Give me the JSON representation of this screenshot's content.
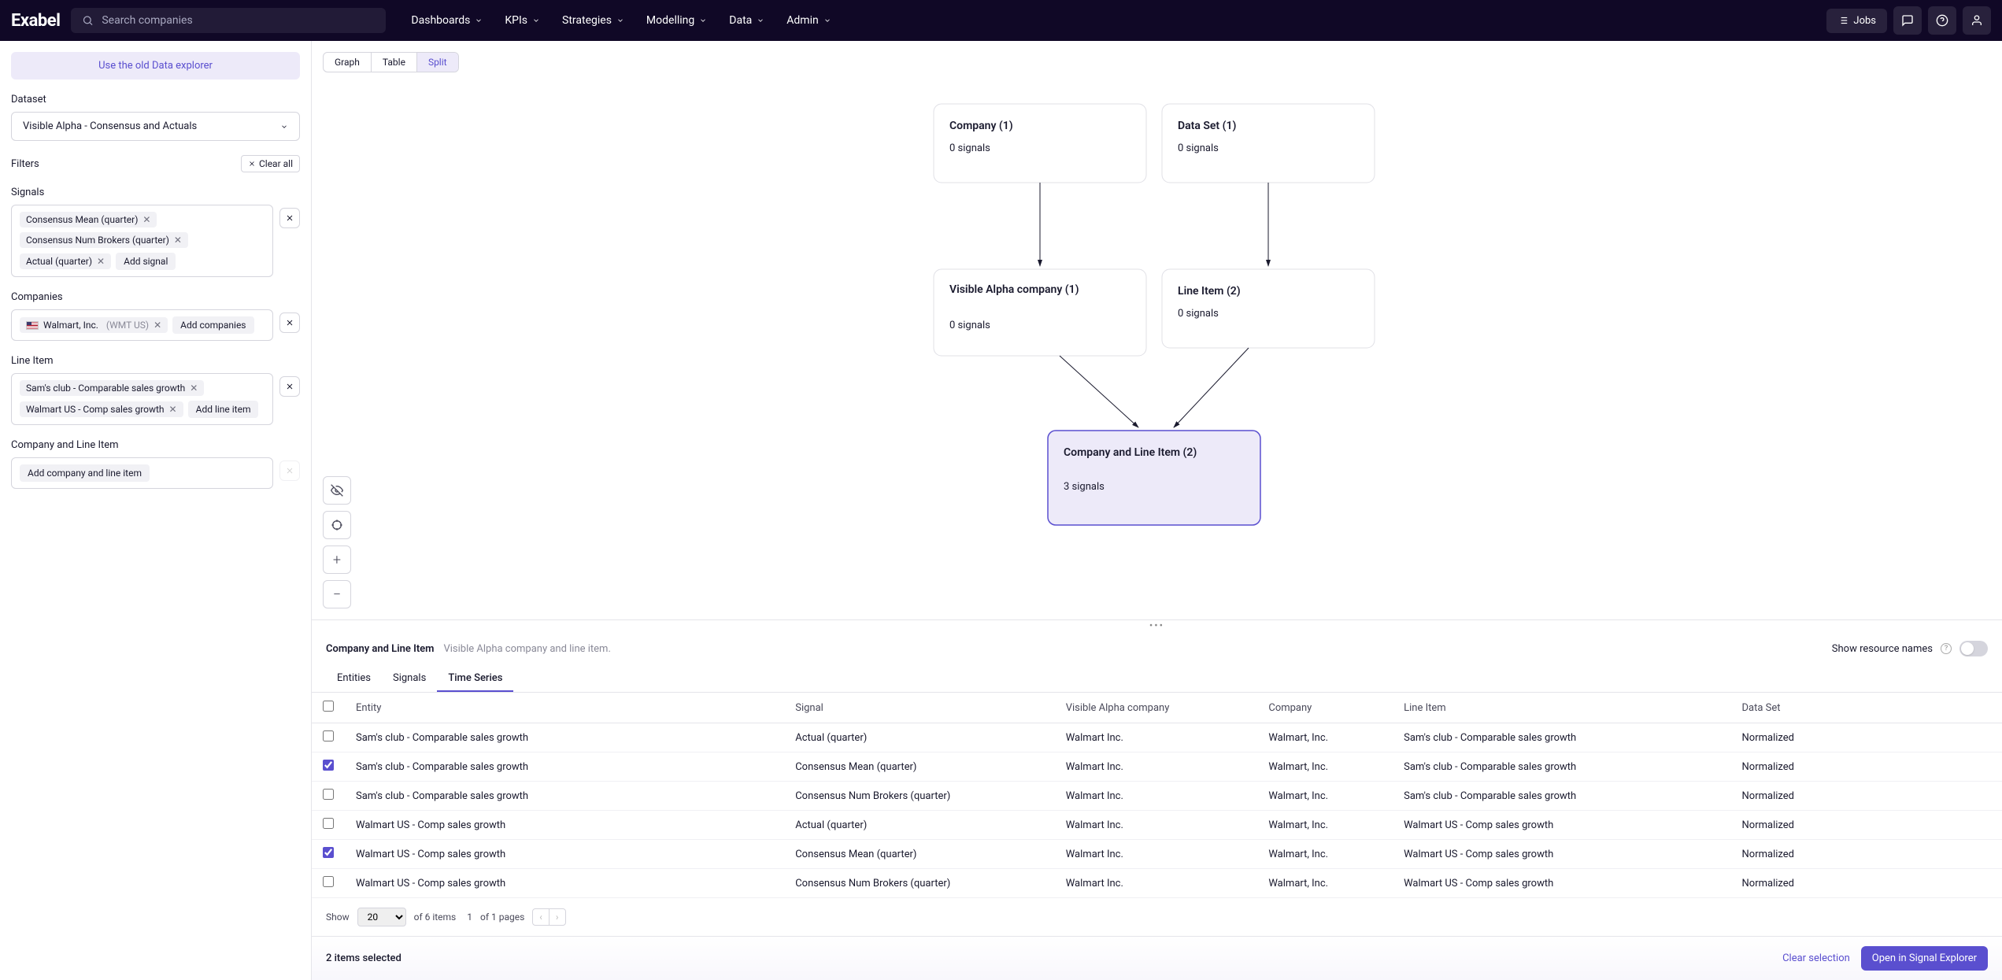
{
  "header": {
    "logo": "Exabel",
    "search_placeholder": "Search companies",
    "nav": [
      "Dashboards",
      "KPIs",
      "Strategies",
      "Modelling",
      "Data",
      "Admin"
    ],
    "jobs_label": "Jobs"
  },
  "sidebar": {
    "old_explorer": "Use the old Data explorer",
    "dataset_label": "Dataset",
    "dataset_value": "Visible Alpha - Consensus and Actuals",
    "filters_label": "Filters",
    "clear_all": "Clear all",
    "signals_label": "Signals",
    "signals": [
      "Consensus Mean (quarter)",
      "Consensus Num Brokers (quarter)",
      "Actual (quarter)"
    ],
    "add_signal": "Add signal",
    "companies_label": "Companies",
    "company_name": "Walmart, Inc.",
    "company_ticker": "(WMT US)",
    "add_companies": "Add companies",
    "lineitem_label": "Line Item",
    "lineitems": [
      "Sam's club - Comparable sales growth",
      "Walmart US - Comp sales growth"
    ],
    "add_lineitem": "Add line item",
    "company_lineitem_label": "Company and Line Item",
    "add_company_lineitem": "Add company and line item"
  },
  "view_tabs": [
    "Graph",
    "Table",
    "Split"
  ],
  "graph": {
    "nodes": {
      "company": {
        "title": "Company (1)",
        "sub": "0 signals"
      },
      "dataset": {
        "title": "Data Set (1)",
        "sub": "0 signals"
      },
      "vacompany": {
        "title": "Visible Alpha company (1)",
        "sub": "0 signals"
      },
      "lineitem": {
        "title": "Line Item (2)",
        "sub": "0 signals"
      },
      "combined": {
        "title": "Company and Line Item (2)",
        "sub": "3 signals"
      }
    }
  },
  "panel": {
    "title": "Company and Line Item",
    "subtitle": "Visible Alpha company and line item.",
    "show_resource": "Show resource names",
    "tabs": [
      "Entities",
      "Signals",
      "Time Series"
    ],
    "columns": [
      "Entity",
      "Signal",
      "Visible Alpha company",
      "Company",
      "Line Item",
      "Data Set"
    ],
    "rows": [
      {
        "checked": false,
        "entity": "Sam's club - Comparable sales growth",
        "signal": "Actual (quarter)",
        "vac": "Walmart Inc.",
        "company": "Walmart, Inc.",
        "li": "Sam's club - Comparable sales growth",
        "ds": "Normalized"
      },
      {
        "checked": true,
        "entity": "Sam's club - Comparable sales growth",
        "signal": "Consensus Mean (quarter)",
        "vac": "Walmart Inc.",
        "company": "Walmart, Inc.",
        "li": "Sam's club - Comparable sales growth",
        "ds": "Normalized"
      },
      {
        "checked": false,
        "entity": "Sam's club - Comparable sales growth",
        "signal": "Consensus Num Brokers (quarter)",
        "vac": "Walmart Inc.",
        "company": "Walmart, Inc.",
        "li": "Sam's club - Comparable sales growth",
        "ds": "Normalized"
      },
      {
        "checked": false,
        "entity": "Walmart US - Comp sales growth",
        "signal": "Actual (quarter)",
        "vac": "Walmart Inc.",
        "company": "Walmart, Inc.",
        "li": "Walmart US - Comp sales growth",
        "ds": "Normalized"
      },
      {
        "checked": true,
        "entity": "Walmart US - Comp sales growth",
        "signal": "Consensus Mean (quarter)",
        "vac": "Walmart Inc.",
        "company": "Walmart, Inc.",
        "li": "Walmart US - Comp sales growth",
        "ds": "Normalized"
      },
      {
        "checked": false,
        "entity": "Walmart US - Comp sales growth",
        "signal": "Consensus Num Brokers (quarter)",
        "vac": "Walmart Inc.",
        "company": "Walmart, Inc.",
        "li": "Walmart US - Comp sales growth",
        "ds": "Normalized"
      }
    ],
    "pager": {
      "show": "Show",
      "size": "20",
      "of_items": "of 6 items",
      "page": "1",
      "of_pages": "of 1 pages"
    }
  },
  "footer": {
    "selected": "2 items selected",
    "clear": "Clear selection",
    "open": "Open in Signal Explorer"
  }
}
